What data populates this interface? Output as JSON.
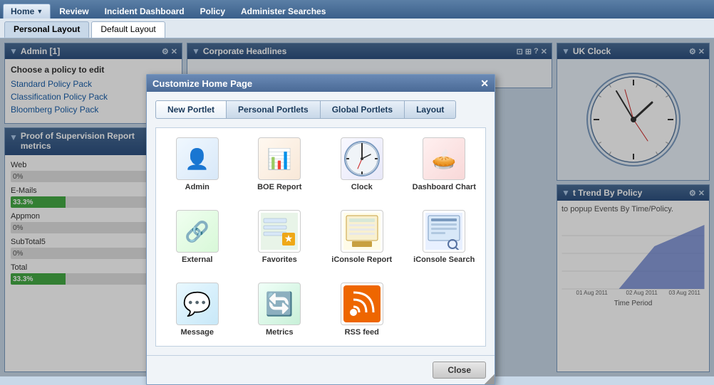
{
  "nav": {
    "tabs": [
      {
        "label": "Home",
        "id": "home",
        "active": true,
        "hasArrow": true
      },
      {
        "label": "Review",
        "id": "review",
        "active": false
      },
      {
        "label": "Incident Dashboard",
        "id": "incident-dashboard",
        "active": false
      },
      {
        "label": "Policy",
        "id": "policy",
        "active": false
      },
      {
        "label": "Administer Searches",
        "id": "administer-searches",
        "active": false
      }
    ]
  },
  "layout_bar": {
    "tabs": [
      {
        "label": "Personal Layout",
        "active": true
      },
      {
        "label": "Default Layout",
        "active": false
      }
    ]
  },
  "admin_panel": {
    "title": "Admin [1]",
    "badge": "1",
    "subtitle": "Choose a policy to edit",
    "links": [
      "Standard Policy Pack",
      "Classification Policy Pack",
      "Bloomberg Policy Pack"
    ]
  },
  "proof_panel": {
    "title": "Proof of Supervision Report metrics",
    "metrics": [
      {
        "label": "Web",
        "value": "0%",
        "pct": 0
      },
      {
        "label": "E-Mails",
        "value": "33.3%",
        "pct": 33.3
      },
      {
        "label": "Appmon",
        "value": "0%",
        "pct": 0
      },
      {
        "label": "SubTotal5",
        "value": "0%",
        "pct": 0
      },
      {
        "label": "Total",
        "value": "33.3%",
        "pct": 33.3
      }
    ]
  },
  "corp_panel": {
    "title": "Corporate Headlines"
  },
  "clock_panel": {
    "title": "UK Clock"
  },
  "trend_panel": {
    "title": "t Trend By Policy",
    "subtitle": "to popup Events By Time/Policy.",
    "dates": [
      "01 Aug 2011",
      "02 Aug 2011",
      "03 Aug 2011"
    ],
    "x_label": "Time Period"
  },
  "modal": {
    "title": "Customize Home Page",
    "close_label": "✕",
    "tabs": [
      {
        "label": "New Portlet",
        "active": true
      },
      {
        "label": "Personal Portlets",
        "active": false
      },
      {
        "label": "Global Portlets",
        "active": false
      },
      {
        "label": "Layout",
        "active": false
      }
    ],
    "portlets": [
      {
        "id": "admin",
        "label": "Admin",
        "icon": "admin"
      },
      {
        "id": "boe-report",
        "label": "BOE Report",
        "icon": "boe"
      },
      {
        "id": "clock",
        "label": "Clock",
        "icon": "clock"
      },
      {
        "id": "dashboard-chart",
        "label": "Dashboard Chart",
        "icon": "dashboard"
      },
      {
        "id": "external",
        "label": "External",
        "icon": "external"
      },
      {
        "id": "favorites",
        "label": "Favorites",
        "icon": "favorites"
      },
      {
        "id": "iconsole-report",
        "label": "iConsole Report",
        "icon": "iconsole-report"
      },
      {
        "id": "iconsole-search",
        "label": "iConsole Search",
        "icon": "iconsole-search"
      },
      {
        "id": "message",
        "label": "Message",
        "icon": "message"
      },
      {
        "id": "metrics",
        "label": "Metrics",
        "icon": "metrics"
      },
      {
        "id": "rss-feed",
        "label": "RSS feed",
        "icon": "rss"
      }
    ],
    "close_button": "Close"
  }
}
